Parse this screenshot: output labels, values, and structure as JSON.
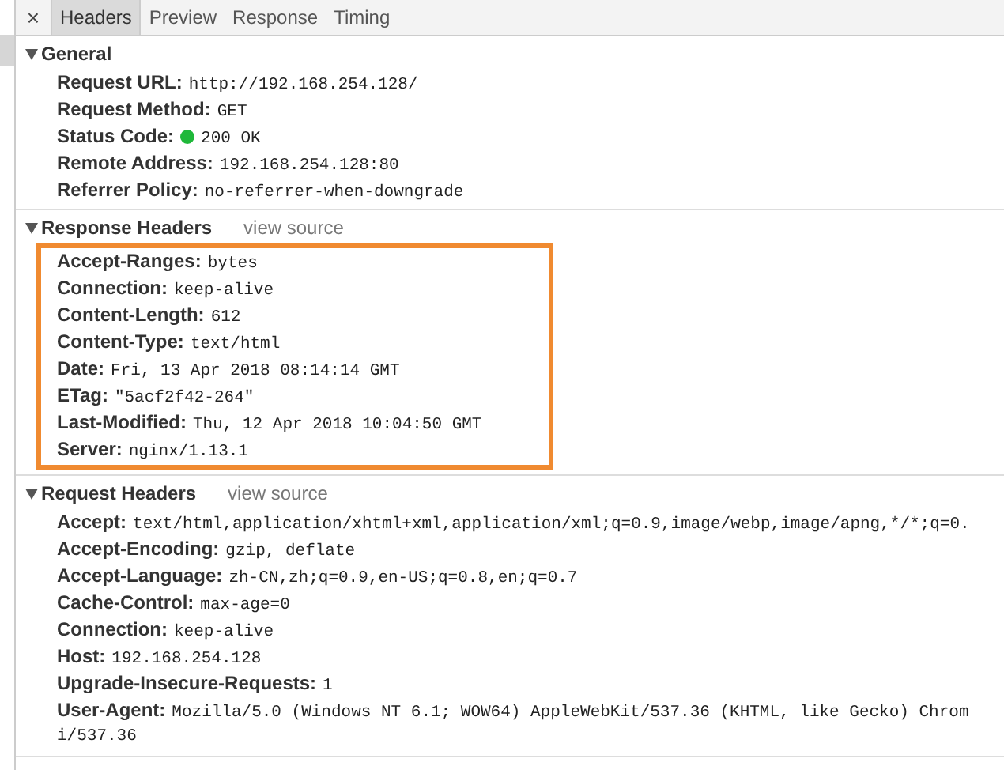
{
  "close_button": {
    "label": "×"
  },
  "tabs": [
    {
      "label": "Headers",
      "selected": true
    },
    {
      "label": "Preview",
      "selected": false
    },
    {
      "label": "Response",
      "selected": false
    },
    {
      "label": "Timing",
      "selected": false
    }
  ],
  "sections": [
    {
      "title": "General",
      "expanded": true,
      "highlighted": false,
      "rows": [
        {
          "name": "Request URL:",
          "value": "http://192.168.254.128/"
        },
        {
          "name": "Request Method:",
          "value": "GET"
        },
        {
          "name": "Status Code:",
          "value": "200 OK",
          "color": "#1fb83a"
        },
        {
          "name": "Remote Address:",
          "value": "192.168.254.128:80"
        },
        {
          "name": "Referrer Policy:",
          "value": "no-referrer-when-downgrade"
        }
      ]
    },
    {
      "title": "Response Headers",
      "link": "view source",
      "expanded": true,
      "highlighted": true,
      "rows": [
        {
          "name": "Accept-Ranges:",
          "value": "bytes"
        },
        {
          "name": "Connection:",
          "value": "keep-alive"
        },
        {
          "name": "Content-Length:",
          "value": "612"
        },
        {
          "name": "Content-Type:",
          "value": "text/html"
        },
        {
          "name": "Date:",
          "value": "Fri, 13 Apr 2018 08:14:14 GMT"
        },
        {
          "name": "ETag:",
          "value": "\"5acf2f42-264\""
        },
        {
          "name": "Last-Modified:",
          "value": "Thu, 12 Apr 2018 10:04:50 GMT"
        },
        {
          "name": "Server:",
          "value": "nginx/1.13.1"
        }
      ]
    },
    {
      "title": "Request Headers",
      "link": "view source",
      "expanded": true,
      "highlighted": false,
      "rows": [
        {
          "name": "Accept:",
          "value": "text/html,application/xhtml+xml,application/xml;q=0.9,image/webp,image/apng,*/*;q=0."
        },
        {
          "name": "Accept-Encoding:",
          "value": "gzip, deflate"
        },
        {
          "name": "Accept-Language:",
          "value": "zh-CN,zh;q=0.9,en-US;q=0.8,en;q=0.7"
        },
        {
          "name": "Cache-Control:",
          "value": "max-age=0"
        },
        {
          "name": "Connection:",
          "value": "keep-alive"
        },
        {
          "name": "Host:",
          "value": "192.168.254.128"
        },
        {
          "name": "Upgrade-Insecure-Requests:",
          "value": "1"
        },
        {
          "name": "User-Agent:",
          "value": "Mozilla/5.0 (Windows NT 6.1; WOW64) AppleWebKit/537.36 (KHTML, like Gecko) Chrom",
          "continuation": "i/537.36"
        }
      ]
    }
  ]
}
